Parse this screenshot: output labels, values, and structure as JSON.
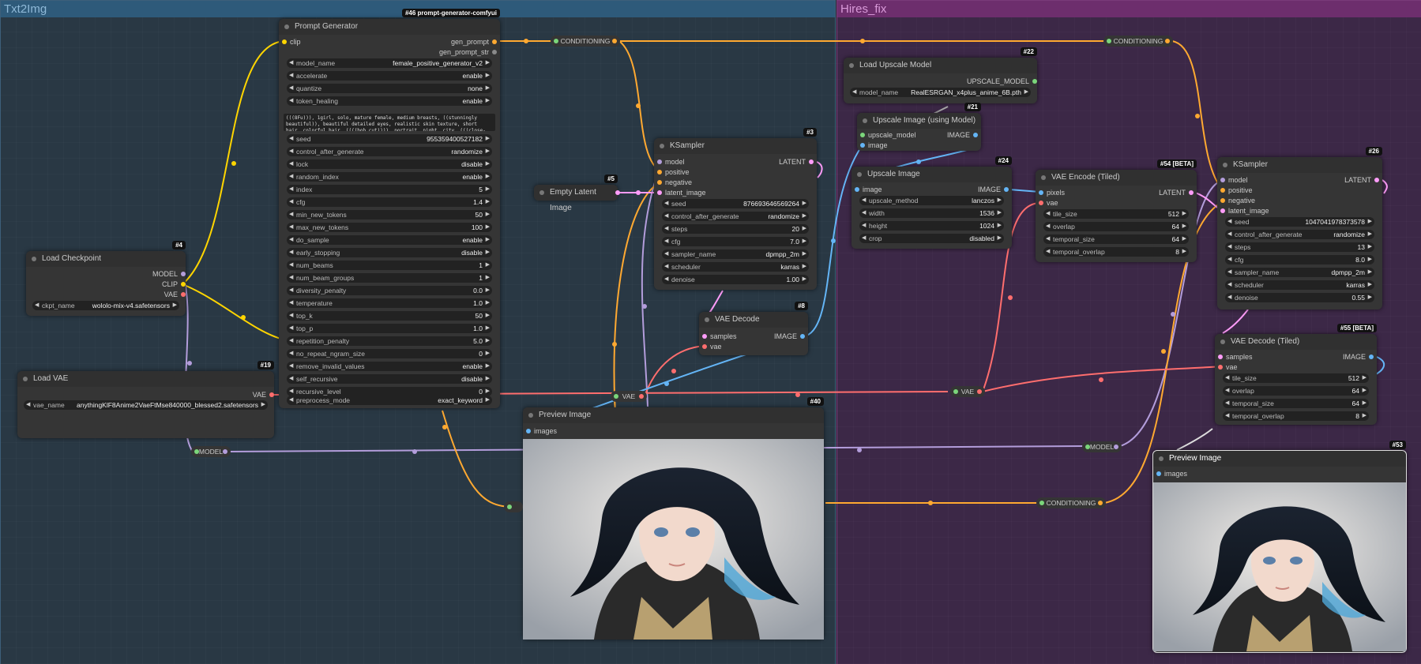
{
  "groups": {
    "txt2img": "Txt2Img",
    "hires": "Hires_fix"
  },
  "colors": {
    "model": "#b39ddb",
    "clip": "#ffd500",
    "vae": "#ff6e6e",
    "conditioning": "#ffa931",
    "latent": "#ff9cf9",
    "image": "#64b5f6"
  },
  "prompt_gen": {
    "id": "#46 prompt-generator-comfyui",
    "title": "Prompt Generator",
    "in_clip": "clip",
    "out_gen_prompt": "gen_prompt",
    "out_gen_prompt_str": "gen_prompt_str",
    "model_name": {
      "label": "model_name",
      "value": "female_positive_generator_v2"
    },
    "accelerate": {
      "label": "accelerate",
      "value": "enable"
    },
    "quantize": {
      "label": "quantize",
      "value": "none"
    },
    "token_healing": {
      "label": "token_healing",
      "value": "enable"
    },
    "text": "(((8Fu))), 1girl, solo, mature female, medium breasts, ((stunningly beautiful)), beautiful detailed eyes, realistic skin texture, short hair, colorful hair, ((((bob_cut)))), portrait, night, city, (((close-up, face)))",
    "seed": {
      "label": "seed",
      "value": "955359400527182"
    },
    "control_after_generate": {
      "label": "control_after_generate",
      "value": "randomize"
    },
    "lock": {
      "label": "lock",
      "value": "disable"
    },
    "random_index": {
      "label": "random_index",
      "value": "enable"
    },
    "index": {
      "label": "index",
      "value": "5"
    },
    "cfg": {
      "label": "cfg",
      "value": "1.4"
    },
    "min_new_tokens": {
      "label": "min_new_tokens",
      "value": "50"
    },
    "max_new_tokens": {
      "label": "max_new_tokens",
      "value": "100"
    },
    "do_sample": {
      "label": "do_sample",
      "value": "enable"
    },
    "early_stopping": {
      "label": "early_stopping",
      "value": "disable"
    },
    "num_beams": {
      "label": "num_beams",
      "value": "1"
    },
    "num_beam_groups": {
      "label": "num_beam_groups",
      "value": "1"
    },
    "diversity_penalty": {
      "label": "diversity_penalty",
      "value": "0.0"
    },
    "temperature": {
      "label": "temperature",
      "value": "1.0"
    },
    "top_k": {
      "label": "top_k",
      "value": "50"
    },
    "top_p": {
      "label": "top_p",
      "value": "1.0"
    },
    "repetition_penalty": {
      "label": "repetition_penalty",
      "value": "5.0"
    },
    "no_repeat_ngram_size": {
      "label": "no_repeat_ngram_size",
      "value": "0"
    },
    "remove_invalid_values": {
      "label": "remove_invalid_values",
      "value": "enable"
    },
    "self_recursive": {
      "label": "self_recursive",
      "value": "disable"
    },
    "recursive_level": {
      "label": "recursive_level",
      "value": "0"
    },
    "preprocess_mode": {
      "label": "preprocess_mode",
      "value": "exact_keyword"
    }
  },
  "load_checkpoint": {
    "id": "#4",
    "title": "Load Checkpoint",
    "out_model": "MODEL",
    "out_clip": "CLIP",
    "out_vae": "VAE",
    "ckpt_name": {
      "label": "ckpt_name",
      "value": "wololo-mix-v4.safetensors"
    }
  },
  "load_vae": {
    "id": "#19",
    "title": "Load VAE",
    "out_vae": "VAE",
    "vae_name": {
      "label": "vae_name",
      "value": "anythingKlF8Anime2VaeFtMse840000_blessed2.safetensors"
    }
  },
  "empty_latent": {
    "id": "#5",
    "title": "Empty Latent Image"
  },
  "ksampler1": {
    "id": "#3",
    "title": "KSampler",
    "in_model": "model",
    "in_positive": "positive",
    "in_negative": "negative",
    "in_latent": "latent_image",
    "out_latent": "LATENT",
    "seed": {
      "label": "seed",
      "value": "876693646569264"
    },
    "control_after_generate": {
      "label": "control_after_generate",
      "value": "randomize"
    },
    "steps": {
      "label": "steps",
      "value": "20"
    },
    "cfg": {
      "label": "cfg",
      "value": "7.0"
    },
    "sampler_name": {
      "label": "sampler_name",
      "value": "dpmpp_2m"
    },
    "scheduler": {
      "label": "scheduler",
      "value": "karras"
    },
    "denoise": {
      "label": "denoise",
      "value": "1.00"
    }
  },
  "vae_decode": {
    "id": "#8",
    "title": "VAE Decode",
    "in_samples": "samples",
    "in_vae": "vae",
    "out_image": "IMAGE"
  },
  "preview1": {
    "id": "#40",
    "title": "Preview Image",
    "in_images": "images"
  },
  "reroutes": {
    "cond1": "CONDITIONING",
    "cond2": "CONDITIONING",
    "cond3": "CONDITIONING",
    "vae1": "VAE",
    "vae2": "VAE",
    "model1": "MODEL",
    "model2": "MODEL"
  },
  "load_upscale": {
    "id": "#22",
    "title": "Load Upscale Model",
    "out": "UPSCALE_MODEL",
    "model_name": {
      "label": "model_name",
      "value": "RealESRGAN_x4plus_anime_6B.pth"
    }
  },
  "upscale_using": {
    "id": "#21",
    "title": "Upscale Image (using Model)",
    "in_upscale_model": "upscale_model",
    "in_image": "image",
    "out_image": "IMAGE"
  },
  "upscale_image": {
    "id": "#24",
    "title": "Upscale Image",
    "in_image": "image",
    "out_image": "IMAGE",
    "upscale_method": {
      "label": "upscale_method",
      "value": "lanczos"
    },
    "width": {
      "label": "width",
      "value": "1536"
    },
    "height": {
      "label": "height",
      "value": "1024"
    },
    "crop": {
      "label": "crop",
      "value": "disabled"
    }
  },
  "vae_encode_tiled": {
    "id": "#54 [BETA]",
    "title": "VAE Encode (Tiled)",
    "in_pixels": "pixels",
    "in_vae": "vae",
    "out_latent": "LATENT",
    "tile_size": {
      "label": "tile_size",
      "value": "512"
    },
    "overlap": {
      "label": "overlap",
      "value": "64"
    },
    "temporal_size": {
      "label": "temporal_size",
      "value": "64"
    },
    "temporal_overlap": {
      "label": "temporal_overlap",
      "value": "8"
    }
  },
  "ksampler2": {
    "id": "#26",
    "title": "KSampler",
    "in_model": "model",
    "in_positive": "positive",
    "in_negative": "negative",
    "in_latent": "latent_image",
    "out_latent": "LATENT",
    "seed": {
      "label": "seed",
      "value": "1047041978373578"
    },
    "control_after_generate": {
      "label": "control_after_generate",
      "value": "randomize"
    },
    "steps": {
      "label": "steps",
      "value": "13"
    },
    "cfg": {
      "label": "cfg",
      "value": "8.0"
    },
    "sampler_name": {
      "label": "sampler_name",
      "value": "dpmpp_2m"
    },
    "scheduler": {
      "label": "scheduler",
      "value": "karras"
    },
    "denoise": {
      "label": "denoise",
      "value": "0.55"
    }
  },
  "vae_decode_tiled": {
    "id": "#55 [BETA]",
    "title": "VAE Decode (Tiled)",
    "in_samples": "samples",
    "in_vae": "vae",
    "out_image": "IMAGE",
    "tile_size": {
      "label": "tile_size",
      "value": "512"
    },
    "overlap": {
      "label": "overlap",
      "value": "64"
    },
    "temporal_size": {
      "label": "temporal_size",
      "value": "64"
    },
    "temporal_overlap": {
      "label": "temporal_overlap",
      "value": "8"
    }
  },
  "preview2": {
    "id": "#53",
    "title": "Preview Image",
    "in_images": "images"
  }
}
